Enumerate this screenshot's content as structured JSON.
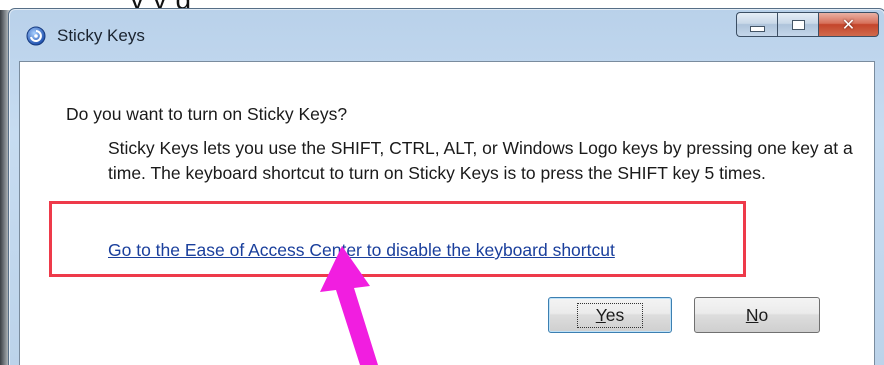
{
  "window": {
    "title": "Sticky Keys",
    "close_glyph": "✕"
  },
  "dialog": {
    "question": "Do you want to turn on Sticky Keys?",
    "description": "Sticky Keys lets you use the SHIFT, CTRL, ALT, or Windows Logo keys by pressing one key at a time. The keyboard shortcut to turn on Sticky Keys is to press the SHIFT key 5 times.",
    "link": "Go to the Ease of Access Center to disable the keyboard shortcut",
    "yes_button": {
      "accel": "Y",
      "rest": "es"
    },
    "no_button": {
      "accel": "N",
      "rest": "o"
    }
  },
  "icons": {
    "app": "ease-of-access-icon",
    "minimize": "minimize-icon",
    "maximize": "maximize-icon",
    "close": "close-icon"
  },
  "colors": {
    "link": "#1a3f9c",
    "annotation_box": "#ee3a4a",
    "annotation_arrow": "#f11ee0",
    "close_button": "#c4452b"
  }
}
